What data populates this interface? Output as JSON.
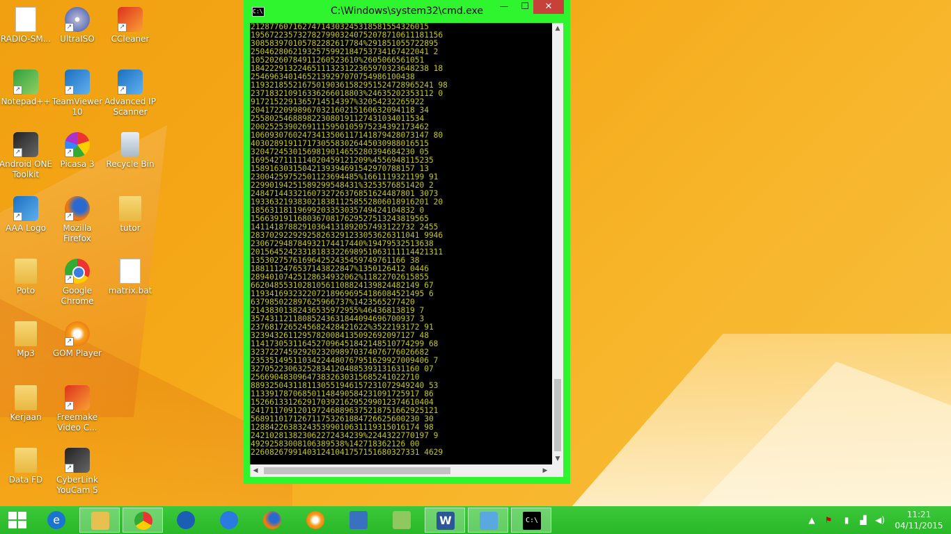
{
  "desktop": {
    "icons": [
      {
        "label": "RADIO-SM..."
      },
      {
        "label": "UltraISO"
      },
      {
        "label": "CCleaner"
      },
      {
        "label": "Notepad++"
      },
      {
        "label": "TeamViewer 10"
      },
      {
        "label": "Advanced IP Scanner"
      },
      {
        "label": "Android ONE Toolkit"
      },
      {
        "label": "Picasa 3"
      },
      {
        "label": "Recycle Bin"
      },
      {
        "label": "AAA Logo"
      },
      {
        "label": "Mozilla Firefox"
      },
      {
        "label": "tutor"
      },
      {
        "label": "Poto"
      },
      {
        "label": "Google Chrome"
      },
      {
        "label": "matrix.bat"
      },
      {
        "label": "Mp3"
      },
      {
        "label": "GOM Player"
      },
      {
        "label": "Kerjaan"
      },
      {
        "label": "Freemake Video C..."
      },
      {
        "label": "Data FD"
      },
      {
        "label": "CyberLink YouCam 5"
      }
    ]
  },
  "cmd": {
    "title": "C:\\Windows\\system32\\cmd.exe",
    "minimize_label": "—",
    "maximize_label": "☐",
    "close_label": "✕",
    "icon_text": "C:\\",
    "output": "21287760716274714303245318581554326015\n19567223573278279903240752078710611181156\n308583970105782282617784%291851055722895\n25046280621932575992184753734167422041 2\n10520260784911260523610%2605066561051\n18422291322465111323122365970323648238 18\n25469634014652139297070754986100438\n119321855216750190361582951524728965241 98\n237183210916336266018803%24635202353112 0\n9172152291365714514397%32054232265922\n20417220998967032160215160632094118 34\n2558025468898223080191127431034011534\n20025253902691115950105975234392173462\n10609307602473413506117141879428073147 80\n40302891911717305583026445030988016515\n32047245301569819014655280394684230 05\n1695427111114020459121209%4556948115235\n15891630315042139394691542970788157 13\n23004259752501123694485%1661119321199 91\n22990194251589299548431%3253576851420 2\n24847144332160732726376851624487801 3073\n19336321938302183811258552806018916201 20\n18563118119699203353035749424104832 0\n15663919116803670817629527513243819565\n14114187882910364131892057493122732 2455\n283702922929258263291233053626311041 9946\n230672948784932174417440%19479532513638\n20156452423318183322698951063111114421311\n135302757616964252435459749761166 38\n1881112476537143822847%1350126412 0446\n28940107425128634932062%11822702615855\n662048553102810561108824139824482149 67\n1193416932322072189696954186084521495 6\n637985022897625966737%1423565277420\n21438301382436535972955%46436813819 7\n35743112118085243631844094696700937 3\n2376817265245682428421622%3522193172 91\n32394326112957820084135092692097127 48\n1141730531164527096451842148510774299 68\n32372274592920232098970374076776026682\n23535149511034224480767951629927009406 7\n327052230632528341204885393131631160 07\n256690483096473832630315685241022710\n8893250431181130551946157231072949240 53\n113391787068501148490584231091725917 86\n152661331262917039216295299012374610404\n2417117091201972468896375218751662925121\n568911017126711753261884726625600230 30\n128842263832435399010631119315016174 98\n242102813823062272434239%2244322770197 9\n49292583008106389538%142718362126 00\n226082679914031241041757151680327331 4629"
  },
  "taskbar": {
    "apps": [
      {
        "name": "internet-explorer"
      },
      {
        "name": "file-explorer"
      },
      {
        "name": "google-chrome"
      },
      {
        "name": "app-blue-1"
      },
      {
        "name": "app-blue-2"
      },
      {
        "name": "firefox"
      },
      {
        "name": "gom-player"
      },
      {
        "name": "network-app"
      },
      {
        "name": "photos-app"
      },
      {
        "name": "word"
      },
      {
        "name": "notepad-app"
      },
      {
        "name": "cmd"
      }
    ],
    "clock_time": "11:21",
    "clock_date": "04/11/2015"
  }
}
